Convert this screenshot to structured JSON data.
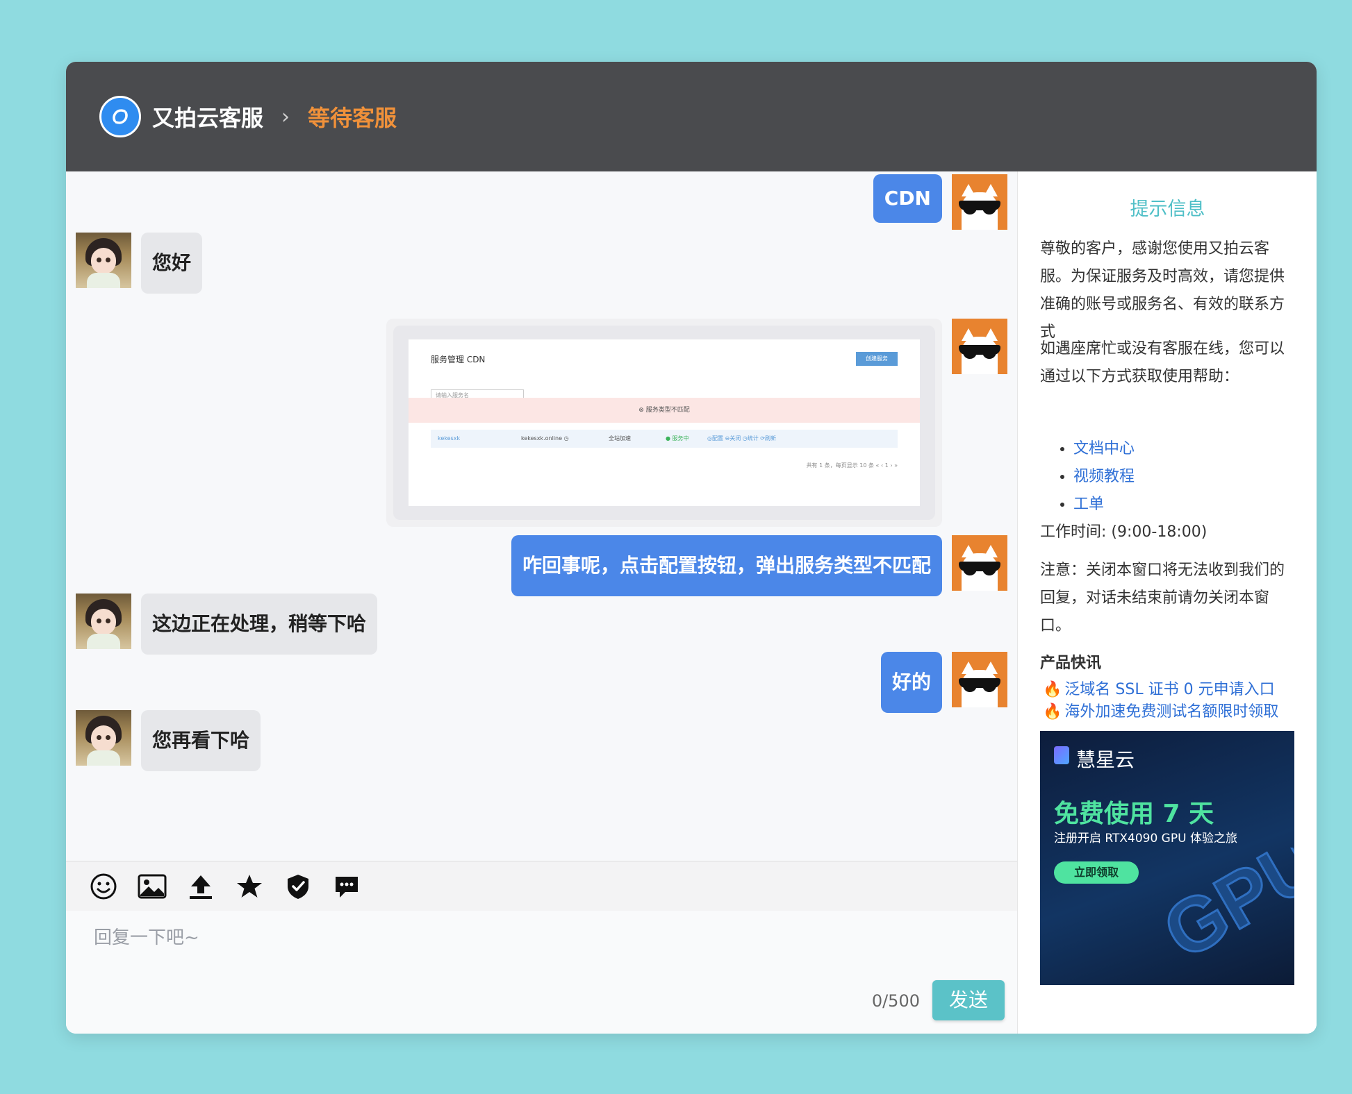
{
  "header": {
    "brand": "又拍云客服",
    "separator": "›",
    "current": "等待客服"
  },
  "messages": [
    {
      "from": "me",
      "type": "text",
      "text": "CDN"
    },
    {
      "from": "agent",
      "type": "text",
      "text": "您好"
    },
    {
      "from": "me",
      "type": "image",
      "shot": {
        "title": "服务管理 CDN",
        "button": "创建服务",
        "search_placeholder": "请输入服务名",
        "alert": "⊗  服务类型不匹配",
        "row": [
          "kekesxk",
          "kekesxk.online ◷",
          "全站加速",
          "● 服务中",
          "◎配置  ⊖关闭  ◷统计  ⟳刷新"
        ],
        "pager": "共有 1 条，每页显示 10 条   «  ‹  1  ›  »"
      }
    },
    {
      "from": "me",
      "type": "text",
      "text": "咋回事呢，点击配置按钮，弹出服务类型不匹配"
    },
    {
      "from": "agent",
      "type": "text",
      "text": "这边正在处理，稍等下哈"
    },
    {
      "from": "me",
      "type": "text",
      "text": "好的"
    },
    {
      "from": "agent",
      "type": "text",
      "text": "您再看下哈"
    }
  ],
  "toolbar": {
    "icons": [
      "smiley-icon",
      "image-icon",
      "upload-icon",
      "star-icon",
      "shield-check-icon",
      "comment-icon"
    ]
  },
  "composer": {
    "placeholder": "回复一下吧~",
    "counter": "0/500",
    "send_label": "发送"
  },
  "sidebar": {
    "title": "提示信息",
    "intro": "尊敬的客户，感谢您使用又拍云客服。为保证服务及时高效，请您提供准确的账号或服务名、有效的联系方式",
    "busy_text": "如遇座席忙或没有客服在线，您可以通过以下方式获取使用帮助：",
    "links": [
      "文档中心",
      "视频教程",
      "工单"
    ],
    "hours": "工作时间: (9:00-18:00)",
    "notice": "注意：关闭本窗口将无法收到我们的回复，对话未结束前请勿关闭本窗口。",
    "news_title": "产品快讯",
    "news": [
      "泛域名 SSL 证书 0 元申请入口",
      "海外加速免费测试名额限时领取"
    ],
    "ad": {
      "brand": "慧星云",
      "headline": "免费使用 7 天",
      "sub": "注册开启 RTX4090 GPU 体验之旅",
      "button": "立即领取",
      "art_text": "GPU"
    }
  },
  "colors": {
    "background": "#8fdbe0",
    "header": "#4a4b4e",
    "accent_orange": "#f0913a",
    "my_bubble": "#4b87e8",
    "agent_bubble": "#e6e7ea",
    "teal": "#5bc2c8",
    "link": "#2e6fd6"
  }
}
